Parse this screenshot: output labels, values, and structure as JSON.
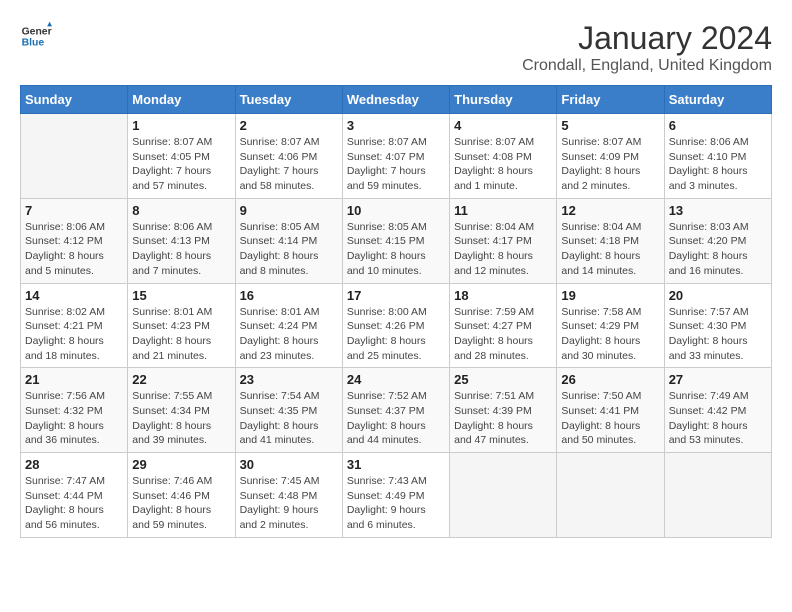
{
  "header": {
    "logo_line1": "General",
    "logo_line2": "Blue",
    "title": "January 2024",
    "subtitle": "Crondall, England, United Kingdom"
  },
  "days_of_week": [
    "Sunday",
    "Monday",
    "Tuesday",
    "Wednesday",
    "Thursday",
    "Friday",
    "Saturday"
  ],
  "weeks": [
    [
      {
        "day": "",
        "info": ""
      },
      {
        "day": "1",
        "info": "Sunrise: 8:07 AM\nSunset: 4:05 PM\nDaylight: 7 hours\nand 57 minutes."
      },
      {
        "day": "2",
        "info": "Sunrise: 8:07 AM\nSunset: 4:06 PM\nDaylight: 7 hours\nand 58 minutes."
      },
      {
        "day": "3",
        "info": "Sunrise: 8:07 AM\nSunset: 4:07 PM\nDaylight: 7 hours\nand 59 minutes."
      },
      {
        "day": "4",
        "info": "Sunrise: 8:07 AM\nSunset: 4:08 PM\nDaylight: 8 hours\nand 1 minute."
      },
      {
        "day": "5",
        "info": "Sunrise: 8:07 AM\nSunset: 4:09 PM\nDaylight: 8 hours\nand 2 minutes."
      },
      {
        "day": "6",
        "info": "Sunrise: 8:06 AM\nSunset: 4:10 PM\nDaylight: 8 hours\nand 3 minutes."
      }
    ],
    [
      {
        "day": "7",
        "info": "Sunrise: 8:06 AM\nSunset: 4:12 PM\nDaylight: 8 hours\nand 5 minutes."
      },
      {
        "day": "8",
        "info": "Sunrise: 8:06 AM\nSunset: 4:13 PM\nDaylight: 8 hours\nand 7 minutes."
      },
      {
        "day": "9",
        "info": "Sunrise: 8:05 AM\nSunset: 4:14 PM\nDaylight: 8 hours\nand 8 minutes."
      },
      {
        "day": "10",
        "info": "Sunrise: 8:05 AM\nSunset: 4:15 PM\nDaylight: 8 hours\nand 10 minutes."
      },
      {
        "day": "11",
        "info": "Sunrise: 8:04 AM\nSunset: 4:17 PM\nDaylight: 8 hours\nand 12 minutes."
      },
      {
        "day": "12",
        "info": "Sunrise: 8:04 AM\nSunset: 4:18 PM\nDaylight: 8 hours\nand 14 minutes."
      },
      {
        "day": "13",
        "info": "Sunrise: 8:03 AM\nSunset: 4:20 PM\nDaylight: 8 hours\nand 16 minutes."
      }
    ],
    [
      {
        "day": "14",
        "info": "Sunrise: 8:02 AM\nSunset: 4:21 PM\nDaylight: 8 hours\nand 18 minutes."
      },
      {
        "day": "15",
        "info": "Sunrise: 8:01 AM\nSunset: 4:23 PM\nDaylight: 8 hours\nand 21 minutes."
      },
      {
        "day": "16",
        "info": "Sunrise: 8:01 AM\nSunset: 4:24 PM\nDaylight: 8 hours\nand 23 minutes."
      },
      {
        "day": "17",
        "info": "Sunrise: 8:00 AM\nSunset: 4:26 PM\nDaylight: 8 hours\nand 25 minutes."
      },
      {
        "day": "18",
        "info": "Sunrise: 7:59 AM\nSunset: 4:27 PM\nDaylight: 8 hours\nand 28 minutes."
      },
      {
        "day": "19",
        "info": "Sunrise: 7:58 AM\nSunset: 4:29 PM\nDaylight: 8 hours\nand 30 minutes."
      },
      {
        "day": "20",
        "info": "Sunrise: 7:57 AM\nSunset: 4:30 PM\nDaylight: 8 hours\nand 33 minutes."
      }
    ],
    [
      {
        "day": "21",
        "info": "Sunrise: 7:56 AM\nSunset: 4:32 PM\nDaylight: 8 hours\nand 36 minutes."
      },
      {
        "day": "22",
        "info": "Sunrise: 7:55 AM\nSunset: 4:34 PM\nDaylight: 8 hours\nand 39 minutes."
      },
      {
        "day": "23",
        "info": "Sunrise: 7:54 AM\nSunset: 4:35 PM\nDaylight: 8 hours\nand 41 minutes."
      },
      {
        "day": "24",
        "info": "Sunrise: 7:52 AM\nSunset: 4:37 PM\nDaylight: 8 hours\nand 44 minutes."
      },
      {
        "day": "25",
        "info": "Sunrise: 7:51 AM\nSunset: 4:39 PM\nDaylight: 8 hours\nand 47 minutes."
      },
      {
        "day": "26",
        "info": "Sunrise: 7:50 AM\nSunset: 4:41 PM\nDaylight: 8 hours\nand 50 minutes."
      },
      {
        "day": "27",
        "info": "Sunrise: 7:49 AM\nSunset: 4:42 PM\nDaylight: 8 hours\nand 53 minutes."
      }
    ],
    [
      {
        "day": "28",
        "info": "Sunrise: 7:47 AM\nSunset: 4:44 PM\nDaylight: 8 hours\nand 56 minutes."
      },
      {
        "day": "29",
        "info": "Sunrise: 7:46 AM\nSunset: 4:46 PM\nDaylight: 8 hours\nand 59 minutes."
      },
      {
        "day": "30",
        "info": "Sunrise: 7:45 AM\nSunset: 4:48 PM\nDaylight: 9 hours\nand 2 minutes."
      },
      {
        "day": "31",
        "info": "Sunrise: 7:43 AM\nSunset: 4:49 PM\nDaylight: 9 hours\nand 6 minutes."
      },
      {
        "day": "",
        "info": ""
      },
      {
        "day": "",
        "info": ""
      },
      {
        "day": "",
        "info": ""
      }
    ]
  ]
}
